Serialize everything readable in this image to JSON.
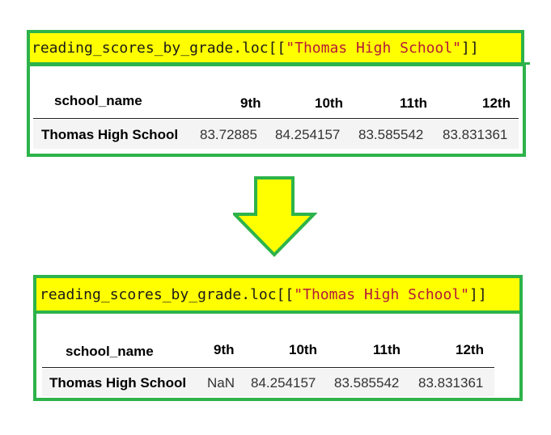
{
  "top": {
    "code": {
      "prefix": "reading_scores_by_grade.loc[[",
      "string": "\"Thomas High School\"",
      "suffix": "]]"
    },
    "table": {
      "index_header": "school_name",
      "columns": [
        "9th",
        "10th",
        "11th",
        "12th"
      ],
      "row_label": "Thomas High School",
      "values": [
        "83.72885",
        "84.254157",
        "83.585542",
        "83.831361"
      ]
    }
  },
  "bottom": {
    "code": {
      "prefix": "reading_scores_by_grade.loc[[",
      "string": "\"Thomas High School\"",
      "suffix": "]]"
    },
    "table": {
      "index_header": "school_name",
      "columns": [
        "9th",
        "10th",
        "11th",
        "12th"
      ],
      "row_label": "Thomas High School",
      "values": [
        "NaN",
        "84.254157",
        "83.585542",
        "83.831361"
      ]
    }
  },
  "colors": {
    "frame": "#2db34a",
    "highlight": "#ffff00",
    "string": "#b5193b",
    "arrow_fill": "#ffff00",
    "arrow_stroke": "#2db34a"
  }
}
